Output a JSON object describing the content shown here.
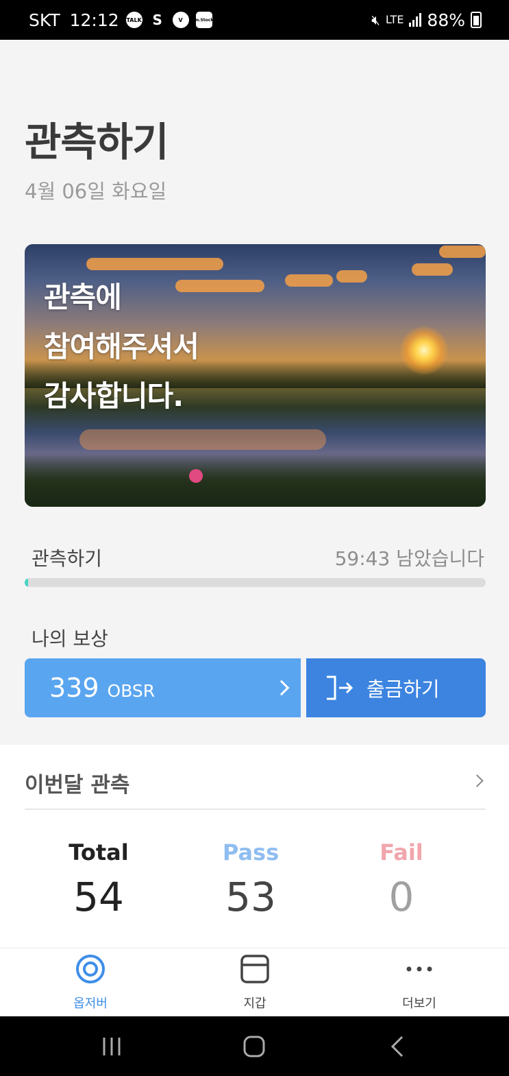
{
  "status_bar": {
    "carrier": "SKT",
    "time": "12:12",
    "notif_icons": [
      "TALK",
      "S",
      "V",
      "m.Stock"
    ],
    "network": "LTE",
    "battery": "88%"
  },
  "header": {
    "title": "관측하기",
    "date": "4월 06일 화요일"
  },
  "banner": {
    "line1": "관측에",
    "line2": "참여해주셔서",
    "line3": "감사합니다."
  },
  "progress": {
    "label": "관측하기",
    "remaining": "59:43 남았습니다",
    "value_fraction": 0.005
  },
  "reward": {
    "label": "나의 보상",
    "amount": "339",
    "unit": "OBSR",
    "withdraw_label": "출금하기"
  },
  "monthly": {
    "title": "이번달 관측",
    "stats": [
      {
        "label": "Total",
        "value": "54",
        "color": "#222222"
      },
      {
        "label": "Pass",
        "value": "53",
        "color": "#8fbdf0"
      },
      {
        "label": "Fail",
        "value": "0",
        "color": "#f0a6ac"
      }
    ]
  },
  "bottom_nav": {
    "items": [
      {
        "label": "옵저버",
        "icon": "observer-logo-icon",
        "active": true
      },
      {
        "label": "지갑",
        "icon": "wallet-icon",
        "active": false
      },
      {
        "label": "더보기",
        "icon": "more-icon",
        "active": false
      }
    ],
    "active_color": "#3f8ee8"
  }
}
